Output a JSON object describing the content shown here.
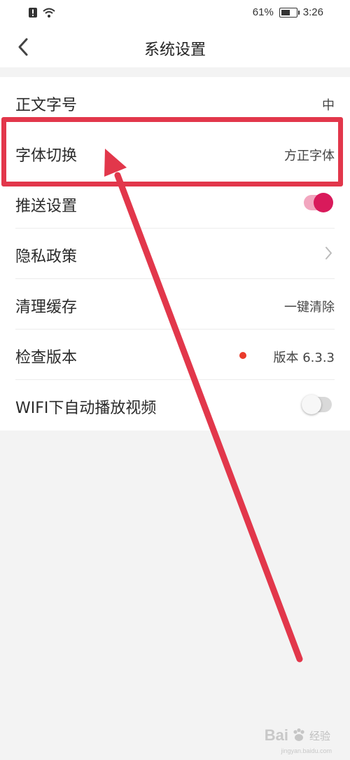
{
  "status_bar": {
    "battery": "61%",
    "time": "3:26",
    "battery_level": 0.61
  },
  "header": {
    "title": "系统设置"
  },
  "settings": {
    "font_size": {
      "label": "正文字号",
      "value": "中"
    },
    "font_switch": {
      "label": "字体切换",
      "value": "方正字体"
    },
    "push": {
      "label": "推送设置",
      "enabled": true
    },
    "privacy": {
      "label": "隐私政策"
    },
    "cache": {
      "label": "清理缓存",
      "value": "一键清除"
    },
    "version": {
      "label": "检查版本",
      "value": "版本 6.3.3"
    },
    "wifi_autoplay": {
      "label": "WIFI下自动播放视频",
      "enabled": false
    }
  },
  "annotation_color": "#e2374b",
  "accent_color": "#d91a5b",
  "watermark": {
    "brand": "Bai",
    "brand_suffix": "经验",
    "sub": "jingyan.baidu.com"
  }
}
